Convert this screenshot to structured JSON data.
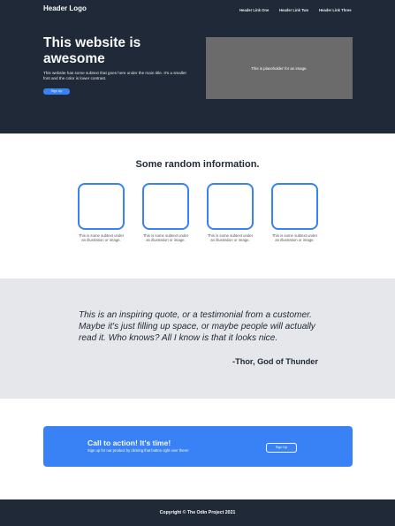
{
  "header": {
    "logo": "Header Logo",
    "nav": [
      "Header Link One",
      "Header Link Two",
      "Header Link Three"
    ]
  },
  "hero": {
    "title": "This website is awesome",
    "subtitle": "This website has some subtext that goes here under the main title. It's a smaller font and the color is lower contrast.",
    "button": "Sign Up",
    "image_placeholder": "This is placeholder for an image."
  },
  "info": {
    "title": "Some random information.",
    "cards": [
      {
        "caption": "This is some subtext under an illustration or image."
      },
      {
        "caption": "This is some subtext under an illustration or image."
      },
      {
        "caption": "This is some subtext under an illustration or image."
      },
      {
        "caption": "This is some subtext under an illustration or image."
      }
    ]
  },
  "testimonial": {
    "quote": "This is an inspiring quote, or a testimonial from a customer. Maybe it's just filling up space, or maybe people will actually read it. Who knows? All I know is that it looks nice.",
    "author": "-Thor, God of Thunder"
  },
  "cta": {
    "title": "Call to action! It's time!",
    "subtitle": "Sign up for our product by clicking that button right over there!",
    "button": "Sign Up"
  },
  "footer": {
    "text": "Copyright © The Odin Project 2021"
  },
  "colors": {
    "dark": "#1f2937",
    "accent": "#3882f6",
    "light_gray": "#e5e7eb"
  }
}
